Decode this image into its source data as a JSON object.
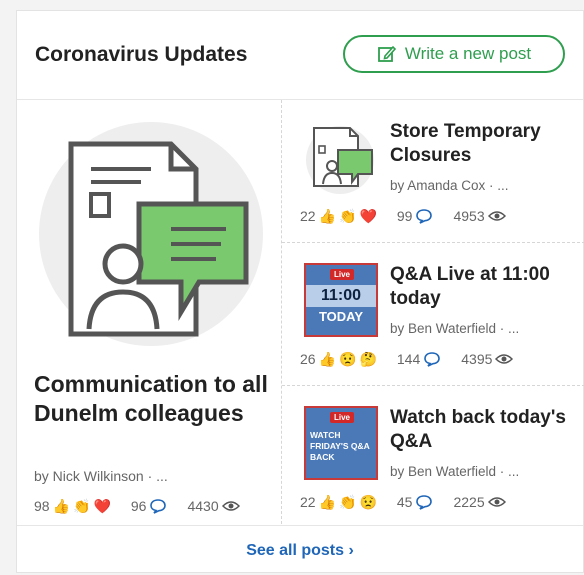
{
  "header": {
    "title": "Coronavirus Updates",
    "write_button_label": "Write a new post"
  },
  "featured": {
    "title": "Communication to all Dunelm colleagues",
    "byline": "by Nick Wilkinson · ...",
    "reaction_count": "98",
    "comment_count": "96",
    "view_count": "4430"
  },
  "posts": [
    {
      "title": "Store Temporary Closures",
      "byline": "by Amanda Cox · ...",
      "reaction_count": "22",
      "comment_count": "99",
      "view_count": "4953"
    },
    {
      "title": "Q&A Live at 11:00 today",
      "byline": "by Ben Waterfield · ...",
      "reaction_count": "26",
      "comment_count": "144",
      "view_count": "4395",
      "thumb_tag": "Live",
      "thumb_time": "11:00",
      "thumb_today": "TODAY"
    },
    {
      "title": "Watch back today's Q&A",
      "byline": "by Ben Waterfield · ...",
      "reaction_count": "22",
      "comment_count": "45",
      "view_count": "2225",
      "thumb_tag": "Live",
      "thumb_text": "WATCH FRIDAY'S Q&A BACK"
    }
  ],
  "footer": {
    "see_all_label": "See all posts ›"
  },
  "colors": {
    "accent_green": "#2f9e4f",
    "link_blue": "#1f66b8",
    "live_red": "#d32828",
    "thumb_blue": "#4b79b8"
  },
  "icons": {
    "write": "edit-icon",
    "comment": "comment-icon",
    "views": "eye-icon",
    "reactions": "reaction-icons"
  }
}
